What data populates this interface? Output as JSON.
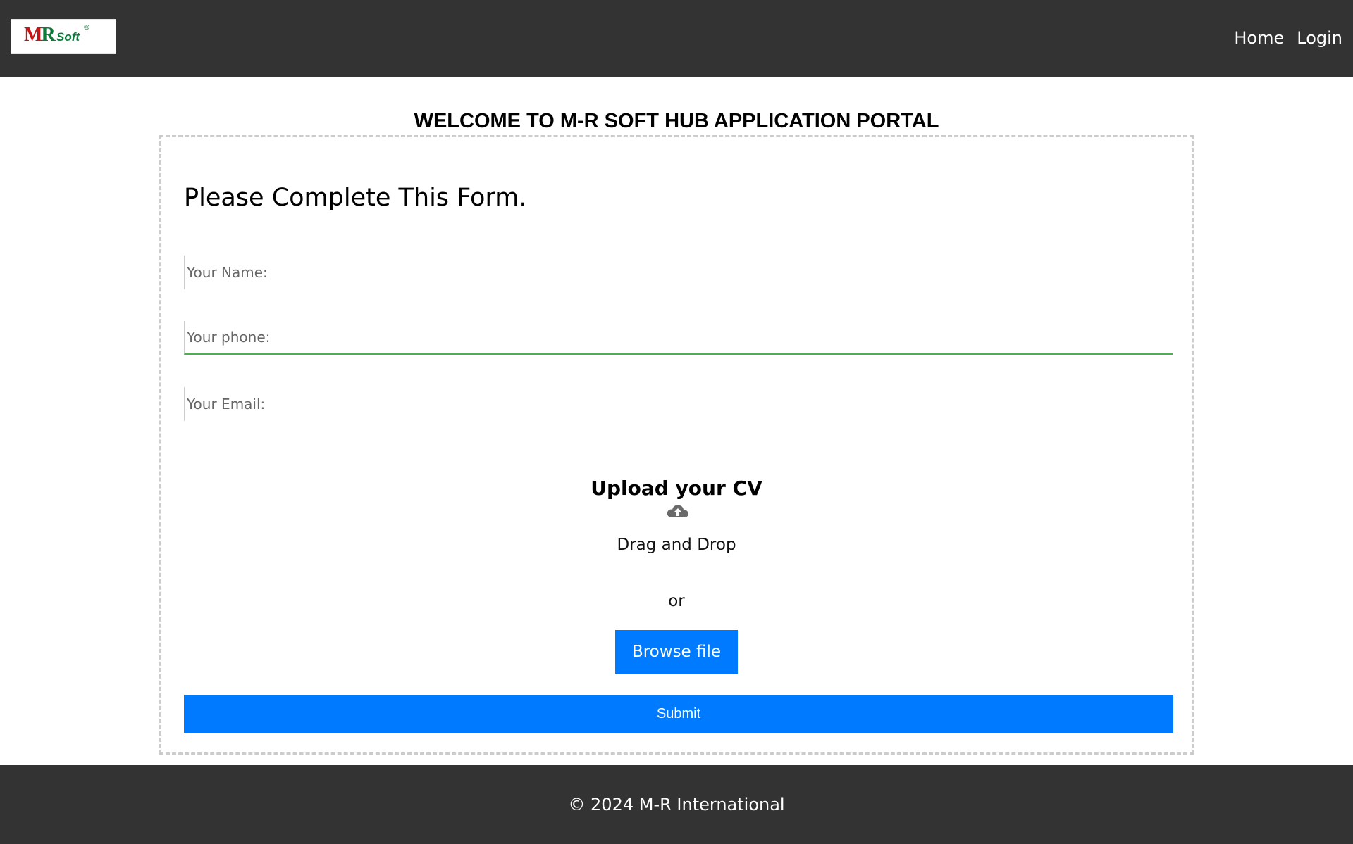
{
  "header": {
    "logo": {
      "mark": "MR",
      "text": "Soft",
      "reg": "®"
    },
    "nav": [
      {
        "label": "Home"
      },
      {
        "label": "Login"
      }
    ]
  },
  "page": {
    "welcome": "WELCOME TO M-R SOFT HUB APPLICATION PORTAL"
  },
  "form": {
    "title": "Please Complete This Form.",
    "name_placeholder": "Your Name:",
    "phone_placeholder": "Your phone:",
    "email_placeholder": "Your Email:",
    "upload": {
      "title": "Upload your CV",
      "icon": "cloud-upload-icon",
      "drag_text": "Drag and Drop",
      "or_text": "or",
      "browse_label": "Browse file"
    },
    "submit_label": "Submit"
  },
  "footer": {
    "text": "© 2024 M-R International"
  },
  "colors": {
    "header_bg": "#333333",
    "primary": "#007bff",
    "active_field_underline": "#4caf50"
  }
}
